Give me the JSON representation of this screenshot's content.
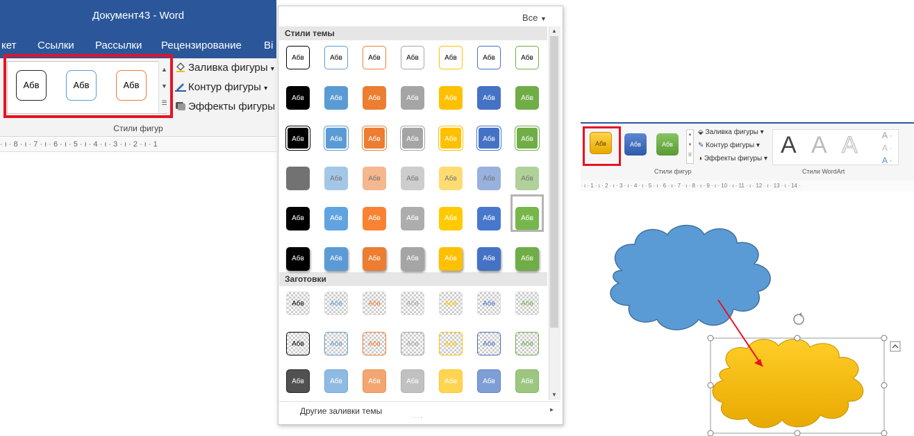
{
  "left_window": {
    "title": "Документ43 - Word",
    "menu": [
      "кет",
      "Ссылки",
      "Рассылки",
      "Рецензирование",
      "Ві"
    ],
    "gallery_tiles": [
      "Абв",
      "Абв",
      "Абв"
    ],
    "commands": {
      "fill": "Заливка фигуры",
      "outline": "Контур фигуры",
      "effects": "Эффекты фигуры"
    },
    "group_label": "Стили фигур",
    "ruler": "· ı · 8 · ı · 7 · ı · 6 · ı · 5 · ı · 4 · ı · 3 · ı · 2 · ı · 1"
  },
  "dropdown": {
    "all_label": "Все",
    "theme_styles_header": "Стили темы",
    "presets_header": "Заготовки",
    "tile_text": "Абв",
    "footer": "Другие заливки темы"
  },
  "right_ribbon": {
    "tile_text": "Абв",
    "commands": {
      "fill": "Заливка фигуры",
      "outline": "Контур фигуры",
      "effects": "Эффекты фигуры"
    },
    "wordart_letter": "A",
    "label_shape_styles": "Стили фигур",
    "label_wordart": "Стили WordArt",
    "ruler": "· ı · 1 · ı · 2 · ı · 3 · ı · 4 · ı · 5 · ı · 6 · ı · 7 · ı · 8 · ı · 9 · ı · 10 · ı · 11 · ı · 12 · ı · 13 · ı · 14 ·"
  },
  "colors": {
    "title_bar": "#2b579a",
    "black": "#000000",
    "blue": "#5b9bd5",
    "orange": "#ed7d31",
    "gray": "#a5a5a5",
    "gold": "#ffc000",
    "dark_blue": "#4472c4",
    "green": "#70ad47",
    "highlight_red": "#e81123",
    "cloud_blue": "#5b9bd5",
    "cloud_yellow": "#ffc000"
  }
}
